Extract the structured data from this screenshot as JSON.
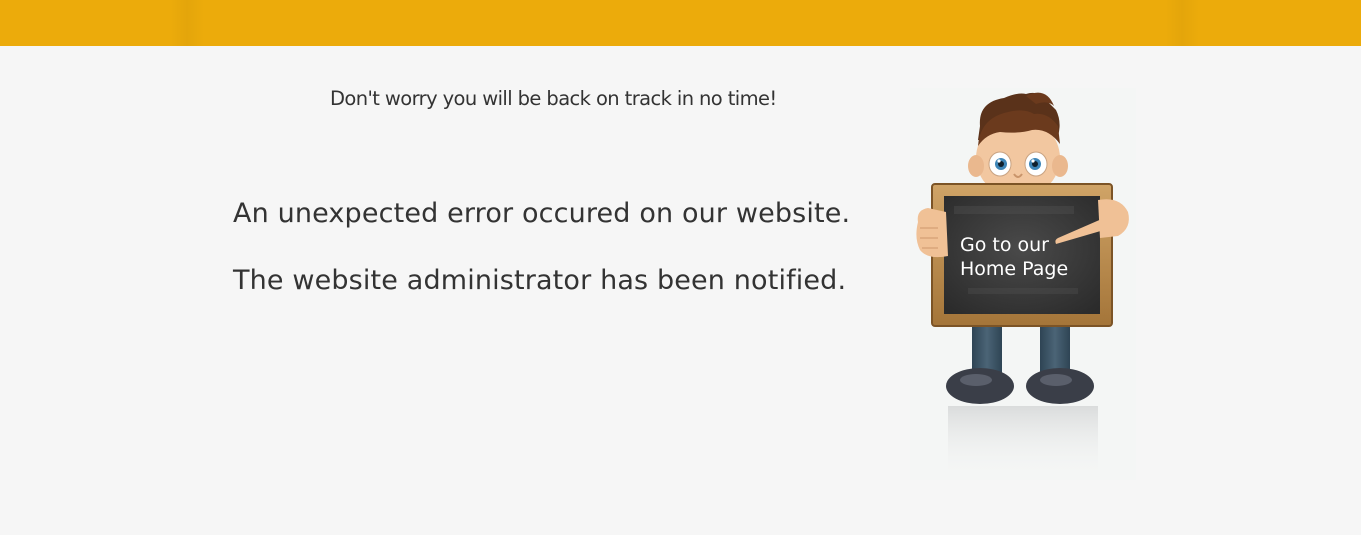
{
  "header": {
    "bar_color": "#ecab0b"
  },
  "message": {
    "subtitle": "Don't worry you will be back on track in no time!",
    "line1": "An unexpected error occured on our website.",
    "line2": "The website administrator has been notified."
  },
  "illustration": {
    "character": "boy-holding-chalkboard",
    "home_link": {
      "line1": "Go to our",
      "line2": "Home Page"
    }
  },
  "colors": {
    "background": "#f6f6f6",
    "text": "#333333",
    "chalkboard": "#3a3a3a",
    "frame": "#b8884a"
  }
}
